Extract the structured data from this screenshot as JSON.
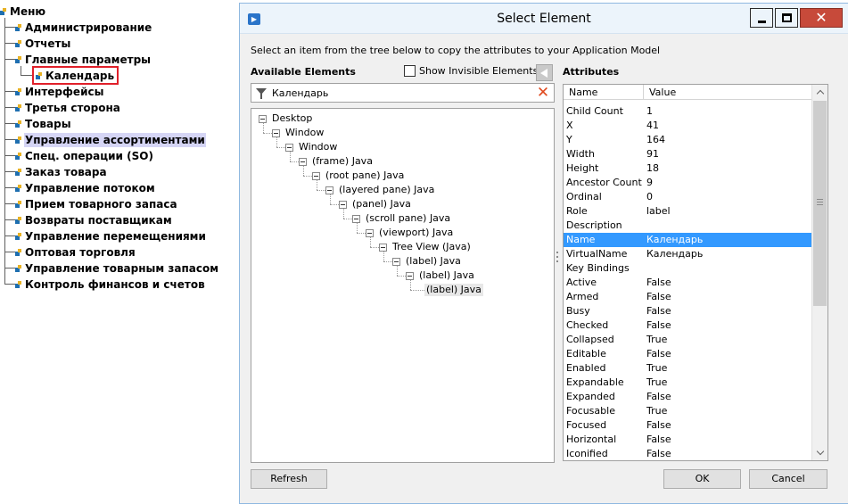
{
  "app_tree": {
    "root": "Меню",
    "items": [
      {
        "label": "Администрирование"
      },
      {
        "label": "Отчеты"
      },
      {
        "label": "Главные параметры",
        "children": [
          {
            "label": "Календарь"
          }
        ]
      },
      {
        "label": "Интерфейсы"
      },
      {
        "label": "Третья сторона"
      },
      {
        "label": "Товары"
      },
      {
        "label": "Управление ассортиментами"
      },
      {
        "label": "Спец. операции (SO)"
      },
      {
        "label": "Заказ товара"
      },
      {
        "label": "Управление потоком"
      },
      {
        "label": "Прием товарного запаса"
      },
      {
        "label": "Возвраты поставщикам"
      },
      {
        "label": "Управление перемещениями"
      },
      {
        "label": "Оптовая торговля"
      },
      {
        "label": "Управление товарным запасом"
      },
      {
        "label": "Контроль финансов и счетов"
      }
    ],
    "selected": "Управление ассортиментами",
    "highlighted": "Календарь",
    "highlight_color": "#e0202a"
  },
  "dialog": {
    "title": "Select Element",
    "instruction": "Select an item from the tree below to copy the attributes to your Application Model",
    "available_label": "Available Elements",
    "show_invisible_label": "Show Invisible Elements",
    "show_invisible_checked": false,
    "attributes_label": "Attributes",
    "filter_value": "Календарь",
    "element_tree": [
      "Desktop",
      "Window",
      "Window",
      "(frame) Java",
      "(root pane) Java",
      "(layered pane) Java",
      "(panel) Java",
      "(scroll pane) Java",
      "(viewport) Java",
      "Tree View (Java)",
      "(label) Java",
      "(label) Java",
      "(label) Java"
    ],
    "attributes": {
      "columns": [
        "Name",
        "Value"
      ],
      "selected_row": "Name",
      "selection_color": "#3399ff",
      "rows": [
        [
          "Child Count",
          "1"
        ],
        [
          "X",
          "41"
        ],
        [
          "Y",
          "164"
        ],
        [
          "Width",
          "91"
        ],
        [
          "Height",
          "18"
        ],
        [
          "Ancestor Count",
          "9"
        ],
        [
          "Ordinal",
          "0"
        ],
        [
          "Role",
          "label"
        ],
        [
          "Description",
          ""
        ],
        [
          "Name",
          "Календарь"
        ],
        [
          "VirtualName",
          "Календарь"
        ],
        [
          "Key Bindings",
          ""
        ],
        [
          "Active",
          "False"
        ],
        [
          "Armed",
          "False"
        ],
        [
          "Busy",
          "False"
        ],
        [
          "Checked",
          "False"
        ],
        [
          "Collapsed",
          "True"
        ],
        [
          "Editable",
          "False"
        ],
        [
          "Enabled",
          "True"
        ],
        [
          "Expandable",
          "True"
        ],
        [
          "Expanded",
          "False"
        ],
        [
          "Focusable",
          "True"
        ],
        [
          "Focused",
          "False"
        ],
        [
          "Horizontal",
          "False"
        ],
        [
          "Iconified",
          "False"
        ]
      ]
    },
    "buttons": {
      "refresh": "Refresh",
      "ok": "OK",
      "cancel": "Cancel"
    },
    "icons": {
      "app": "app-icon",
      "filter": "filter-icon",
      "clear": "clear-icon",
      "collapse": "collapse-left-icon"
    }
  }
}
